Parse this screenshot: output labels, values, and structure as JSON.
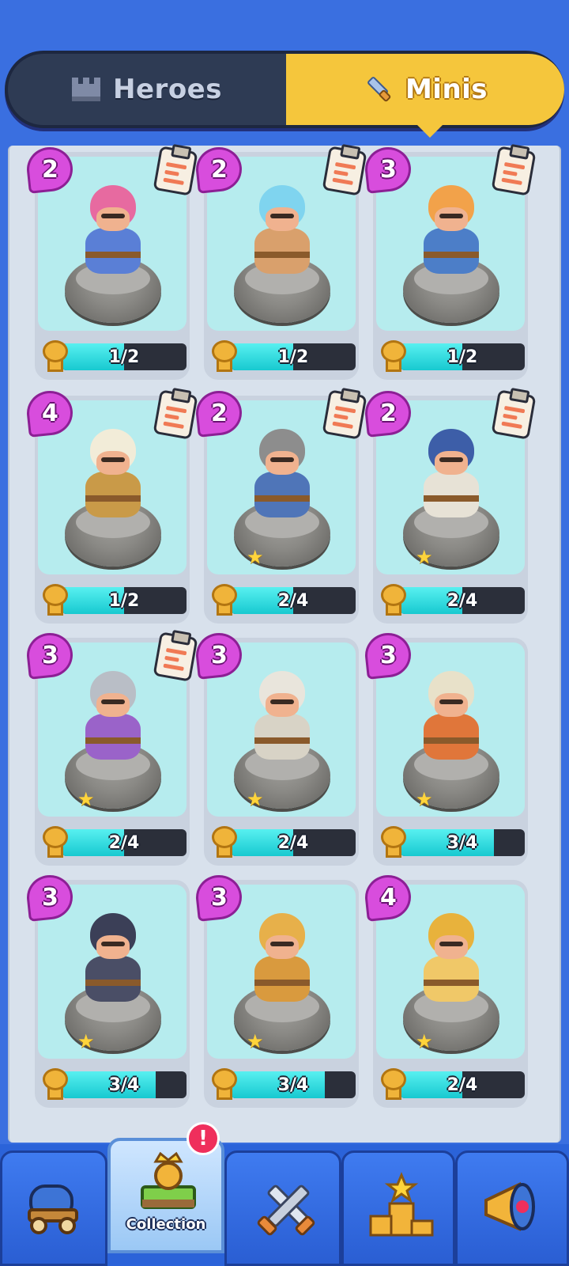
{
  "tabs": {
    "heroes_label": "Heroes",
    "minis_label": "Minis",
    "selected": "Minis"
  },
  "minis": [
    {
      "cost": "2",
      "progress_text": "1/2",
      "progress": 0.5,
      "has_clipboard": true,
      "star": false,
      "hair": "#e76aa0",
      "body": "#5a7fd6"
    },
    {
      "cost": "2",
      "progress_text": "1/2",
      "progress": 0.5,
      "has_clipboard": true,
      "star": false,
      "hair": "#7fd4ef",
      "body": "#d9a06c"
    },
    {
      "cost": "3",
      "progress_text": "1/2",
      "progress": 0.5,
      "has_clipboard": true,
      "star": false,
      "hair": "#f2a24a",
      "body": "#4c7ec8"
    },
    {
      "cost": "4",
      "progress_text": "1/2",
      "progress": 0.5,
      "has_clipboard": true,
      "star": false,
      "hair": "#f2ecd8",
      "body": "#c99a48"
    },
    {
      "cost": "2",
      "progress_text": "2/4",
      "progress": 0.5,
      "has_clipboard": true,
      "star": true,
      "hair": "#8d8d8d",
      "body": "#4f75b8"
    },
    {
      "cost": "2",
      "progress_text": "2/4",
      "progress": 0.5,
      "has_clipboard": true,
      "star": true,
      "hair": "#3d5ea8",
      "body": "#e7e2d6"
    },
    {
      "cost": "3",
      "progress_text": "2/4",
      "progress": 0.5,
      "has_clipboard": true,
      "star": true,
      "hair": "#b9bec6",
      "body": "#9a63c9"
    },
    {
      "cost": "3",
      "progress_text": "2/4",
      "progress": 0.5,
      "has_clipboard": false,
      "star": true,
      "hair": "#e9e5dc",
      "body": "#d8d3c6"
    },
    {
      "cost": "3",
      "progress_text": "3/4",
      "progress": 0.75,
      "has_clipboard": false,
      "star": true,
      "hair": "#e8e1c9",
      "body": "#e0763a"
    },
    {
      "cost": "3",
      "progress_text": "3/4",
      "progress": 0.75,
      "has_clipboard": false,
      "star": true,
      "hair": "#3b3f57",
      "body": "#4a4e66"
    },
    {
      "cost": "3",
      "progress_text": "3/4",
      "progress": 0.75,
      "has_clipboard": false,
      "star": true,
      "hair": "#e7b04a",
      "body": "#d99a3e"
    },
    {
      "cost": "4",
      "progress_text": "2/4",
      "progress": 0.5,
      "has_clipboard": false,
      "star": true,
      "hair": "#e8b23c",
      "body": "#f0c868"
    }
  ],
  "bottom_nav": {
    "collection_label": "Collection",
    "alert": "!"
  },
  "colors": {
    "background": "#3a6fe0",
    "tab_active": "#f5c63c",
    "cost_badge": "#d84ddd",
    "progress_fill": "#2fdde0"
  }
}
